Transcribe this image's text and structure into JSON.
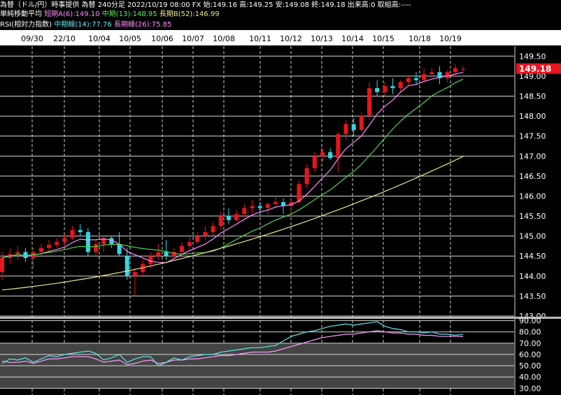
{
  "header": {
    "line1": "為替（ドル/円）時事提供 為替 240分足 2022/10/19 08:00 FX 始:149.16 高:149.25 安:149.08 終:149.18 出来高:0 取組高:----",
    "ma_title": "単純移動平均",
    "ma_short": "短期A(6):149.10",
    "ma_mid": "中期(13):148.95",
    "ma_long": "長期B(52):146.99",
    "rsi_title": "RSI(相対力指数)",
    "rsi_mid": "中期線(14):77.76",
    "rsi_long": "長期線(26):75.85"
  },
  "colors": {
    "bg": "#000000",
    "up": "#e8141e",
    "down": "#35d6e6",
    "ma_short": "#ff8cff",
    "ma_mid": "#4cd64c",
    "ma_long": "#f0e68c",
    "rsi_short": "#5ee8f0",
    "rsi_long": "#ff9cff",
    "grid": "#d8d8d8",
    "last_price_bg": "#e8141e"
  },
  "chart_data": {
    "type": "candlestick",
    "x_date_labels": [
      "09/30",
      "22/10",
      "10/04",
      "10/05",
      "10/06",
      "10/07",
      "10/08",
      "10/11",
      "10/12",
      "10/13",
      "10/14",
      "10/15",
      "10/18",
      "10/19"
    ],
    "price_ticks": [
      "149.50",
      "149.00",
      "148.50",
      "148.00",
      "147.50",
      "147.00",
      "146.50",
      "146.00",
      "145.50",
      "145.00",
      "144.50",
      "144.00",
      "143.50",
      "143.00"
    ],
    "ylim": [
      143.0,
      149.75
    ],
    "last_price": "149.18",
    "candles": [
      [
        144.1,
        144.6,
        143.9,
        144.45
      ],
      [
        144.45,
        144.7,
        144.3,
        144.55
      ],
      [
        144.55,
        144.75,
        144.4,
        144.6
      ],
      [
        144.6,
        144.7,
        144.35,
        144.45
      ],
      [
        144.45,
        144.7,
        144.2,
        144.6
      ],
      [
        144.6,
        144.8,
        144.5,
        144.7
      ],
      [
        144.7,
        144.9,
        144.6,
        144.78
      ],
      [
        144.78,
        144.95,
        144.7,
        144.85
      ],
      [
        144.85,
        145.05,
        144.75,
        144.95
      ],
      [
        144.95,
        145.25,
        144.9,
        145.15
      ],
      [
        145.15,
        145.3,
        145.0,
        145.1
      ],
      [
        145.1,
        145.2,
        144.5,
        144.6
      ],
      [
        144.6,
        144.9,
        144.5,
        144.8
      ],
      [
        144.8,
        145.0,
        144.6,
        144.95
      ],
      [
        144.95,
        145.0,
        144.7,
        144.8
      ],
      [
        144.8,
        145.1,
        144.5,
        144.55
      ],
      [
        144.5,
        144.7,
        143.9,
        144.0
      ],
      [
        144.0,
        144.2,
        143.5,
        144.1
      ],
      [
        144.1,
        144.4,
        144.0,
        144.3
      ],
      [
        144.3,
        144.6,
        144.2,
        144.5
      ],
      [
        144.5,
        144.8,
        144.4,
        144.6
      ],
      [
        144.6,
        144.9,
        144.4,
        144.5
      ],
      [
        144.5,
        144.7,
        144.4,
        144.6
      ],
      [
        144.6,
        144.85,
        144.5,
        144.75
      ],
      [
        144.75,
        145.0,
        144.65,
        144.85
      ],
      [
        144.85,
        145.1,
        144.8,
        145.0
      ],
      [
        145.0,
        145.25,
        144.9,
        145.1
      ],
      [
        145.1,
        145.35,
        145.0,
        145.25
      ],
      [
        145.25,
        145.6,
        145.15,
        145.5
      ],
      [
        145.5,
        145.7,
        145.3,
        145.4
      ],
      [
        145.4,
        145.65,
        145.35,
        145.55
      ],
      [
        145.55,
        145.8,
        145.45,
        145.7
      ],
      [
        145.7,
        145.9,
        145.55,
        145.75
      ],
      [
        145.75,
        145.85,
        145.6,
        145.7
      ],
      [
        145.7,
        145.85,
        145.55,
        145.8
      ],
      [
        145.8,
        146.0,
        145.7,
        145.85
      ],
      [
        145.85,
        145.95,
        145.55,
        145.75
      ],
      [
        145.75,
        145.95,
        145.5,
        145.85
      ],
      [
        145.85,
        146.4,
        145.8,
        146.3
      ],
      [
        146.3,
        146.8,
        146.2,
        146.7
      ],
      [
        146.7,
        147.1,
        146.6,
        147.0
      ],
      [
        147.0,
        147.2,
        146.85,
        147.1
      ],
      [
        147.1,
        147.2,
        146.9,
        146.95
      ],
      [
        146.95,
        147.6,
        146.6,
        147.55
      ],
      [
        147.55,
        147.9,
        147.4,
        147.8
      ],
      [
        147.8,
        147.95,
        147.5,
        147.65
      ],
      [
        147.65,
        148.1,
        147.6,
        148.0
      ],
      [
        148.0,
        148.85,
        147.9,
        148.7
      ],
      [
        148.7,
        148.9,
        148.5,
        148.6
      ],
      [
        148.6,
        148.85,
        148.5,
        148.75
      ],
      [
        148.75,
        148.95,
        148.55,
        148.7
      ],
      [
        148.7,
        148.9,
        148.6,
        148.85
      ],
      [
        148.85,
        149.0,
        148.75,
        148.95
      ],
      [
        148.95,
        149.1,
        148.8,
        148.9
      ],
      [
        148.9,
        149.2,
        148.85,
        149.05
      ],
      [
        149.05,
        149.2,
        148.95,
        149.1
      ],
      [
        149.1,
        149.25,
        148.8,
        148.95
      ],
      [
        148.95,
        149.15,
        148.85,
        149.1
      ],
      [
        149.1,
        149.3,
        149.05,
        149.2
      ],
      [
        149.16,
        149.25,
        149.08,
        149.18
      ]
    ],
    "ma_long_endpoints": [
      143.65,
      146.99
    ],
    "rsi_ticks": [
      "90.00",
      "80.00",
      "70.00",
      "60.00",
      "50.00",
      "40.00",
      "30.00"
    ],
    "rsi_ylim": [
      24,
      91
    ],
    "rsi_short": [
      52,
      56,
      55,
      57,
      53,
      56,
      59,
      58,
      60,
      61,
      62,
      63,
      61,
      55,
      57,
      60,
      53,
      56,
      58,
      58,
      50,
      53,
      57,
      55,
      58,
      59,
      60,
      60,
      62,
      63,
      64,
      65,
      66,
      66,
      67,
      68,
      72,
      76,
      78,
      80,
      81,
      83,
      85,
      86,
      87,
      86,
      87,
      88,
      89,
      85,
      83,
      82,
      80,
      80,
      79,
      80,
      78,
      78,
      77,
      77.76
    ],
    "rsi_long": [
      54,
      53,
      53,
      54,
      52,
      54,
      56,
      56,
      57,
      58,
      58,
      58,
      56,
      53,
      54,
      55,
      51,
      52,
      54,
      55,
      52,
      53,
      55,
      55,
      56,
      56,
      57,
      58,
      59,
      59,
      60,
      61,
      62,
      62,
      62,
      63,
      65,
      67,
      69,
      71,
      73,
      75,
      76,
      77,
      78,
      78,
      79,
      80,
      81,
      80,
      79,
      79,
      78,
      78,
      77,
      77,
      76,
      76,
      76,
      75.85
    ]
  }
}
